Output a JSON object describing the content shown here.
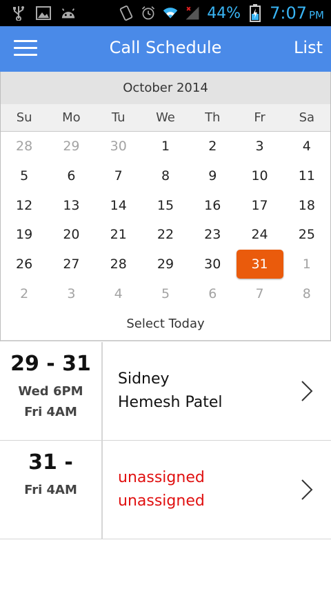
{
  "status_bar": {
    "icons_left": [
      "usb-icon",
      "image-icon",
      "android-icon"
    ],
    "icons_right": [
      "vibrate-icon",
      "alarm-icon",
      "wifi-icon",
      "signal-icon",
      "battery-icon"
    ],
    "battery_percent": "44%",
    "time": "7:07",
    "ampm": "PM",
    "accent_color": "#39b5f5"
  },
  "app_bar": {
    "title": "Call Schedule",
    "list_label": "List",
    "color": "#4a8ae8"
  },
  "calendar": {
    "month_label": "October 2014",
    "weekdays": [
      "Su",
      "Mo",
      "Tu",
      "We",
      "Th",
      "Fr",
      "Sa"
    ],
    "weeks": [
      [
        {
          "d": "28",
          "muted": true
        },
        {
          "d": "29",
          "muted": true
        },
        {
          "d": "30",
          "muted": true
        },
        {
          "d": "1"
        },
        {
          "d": "2"
        },
        {
          "d": "3"
        },
        {
          "d": "4"
        }
      ],
      [
        {
          "d": "5"
        },
        {
          "d": "6"
        },
        {
          "d": "7"
        },
        {
          "d": "8"
        },
        {
          "d": "9"
        },
        {
          "d": "10"
        },
        {
          "d": "11"
        }
      ],
      [
        {
          "d": "12"
        },
        {
          "d": "13"
        },
        {
          "d": "14"
        },
        {
          "d": "15"
        },
        {
          "d": "16"
        },
        {
          "d": "17"
        },
        {
          "d": "18"
        }
      ],
      [
        {
          "d": "19"
        },
        {
          "d": "20"
        },
        {
          "d": "21"
        },
        {
          "d": "22"
        },
        {
          "d": "23"
        },
        {
          "d": "24"
        },
        {
          "d": "25"
        }
      ],
      [
        {
          "d": "26"
        },
        {
          "d": "27"
        },
        {
          "d": "28"
        },
        {
          "d": "29"
        },
        {
          "d": "30"
        },
        {
          "d": "31",
          "selected": true
        },
        {
          "d": "1",
          "muted": true
        }
      ],
      [
        {
          "d": "2",
          "muted": true
        },
        {
          "d": "3",
          "muted": true
        },
        {
          "d": "4",
          "muted": true
        },
        {
          "d": "5",
          "muted": true
        },
        {
          "d": "6",
          "muted": true
        },
        {
          "d": "7",
          "muted": true
        },
        {
          "d": "8",
          "muted": true
        }
      ]
    ],
    "selected_color": "#ea5b0c",
    "select_today_label": "Select Today"
  },
  "schedule": [
    {
      "range": "29 - 31",
      "start": "Wed 6PM",
      "end": "Fri 4AM",
      "names": [
        "Sidney",
        "Hemesh Patel"
      ],
      "unassigned": false
    },
    {
      "range": "31 -",
      "start": "Fri 4AM",
      "end": "",
      "names": [
        "unassigned",
        "unassigned"
      ],
      "unassigned": true
    }
  ],
  "unassigned_color": "#e01010"
}
